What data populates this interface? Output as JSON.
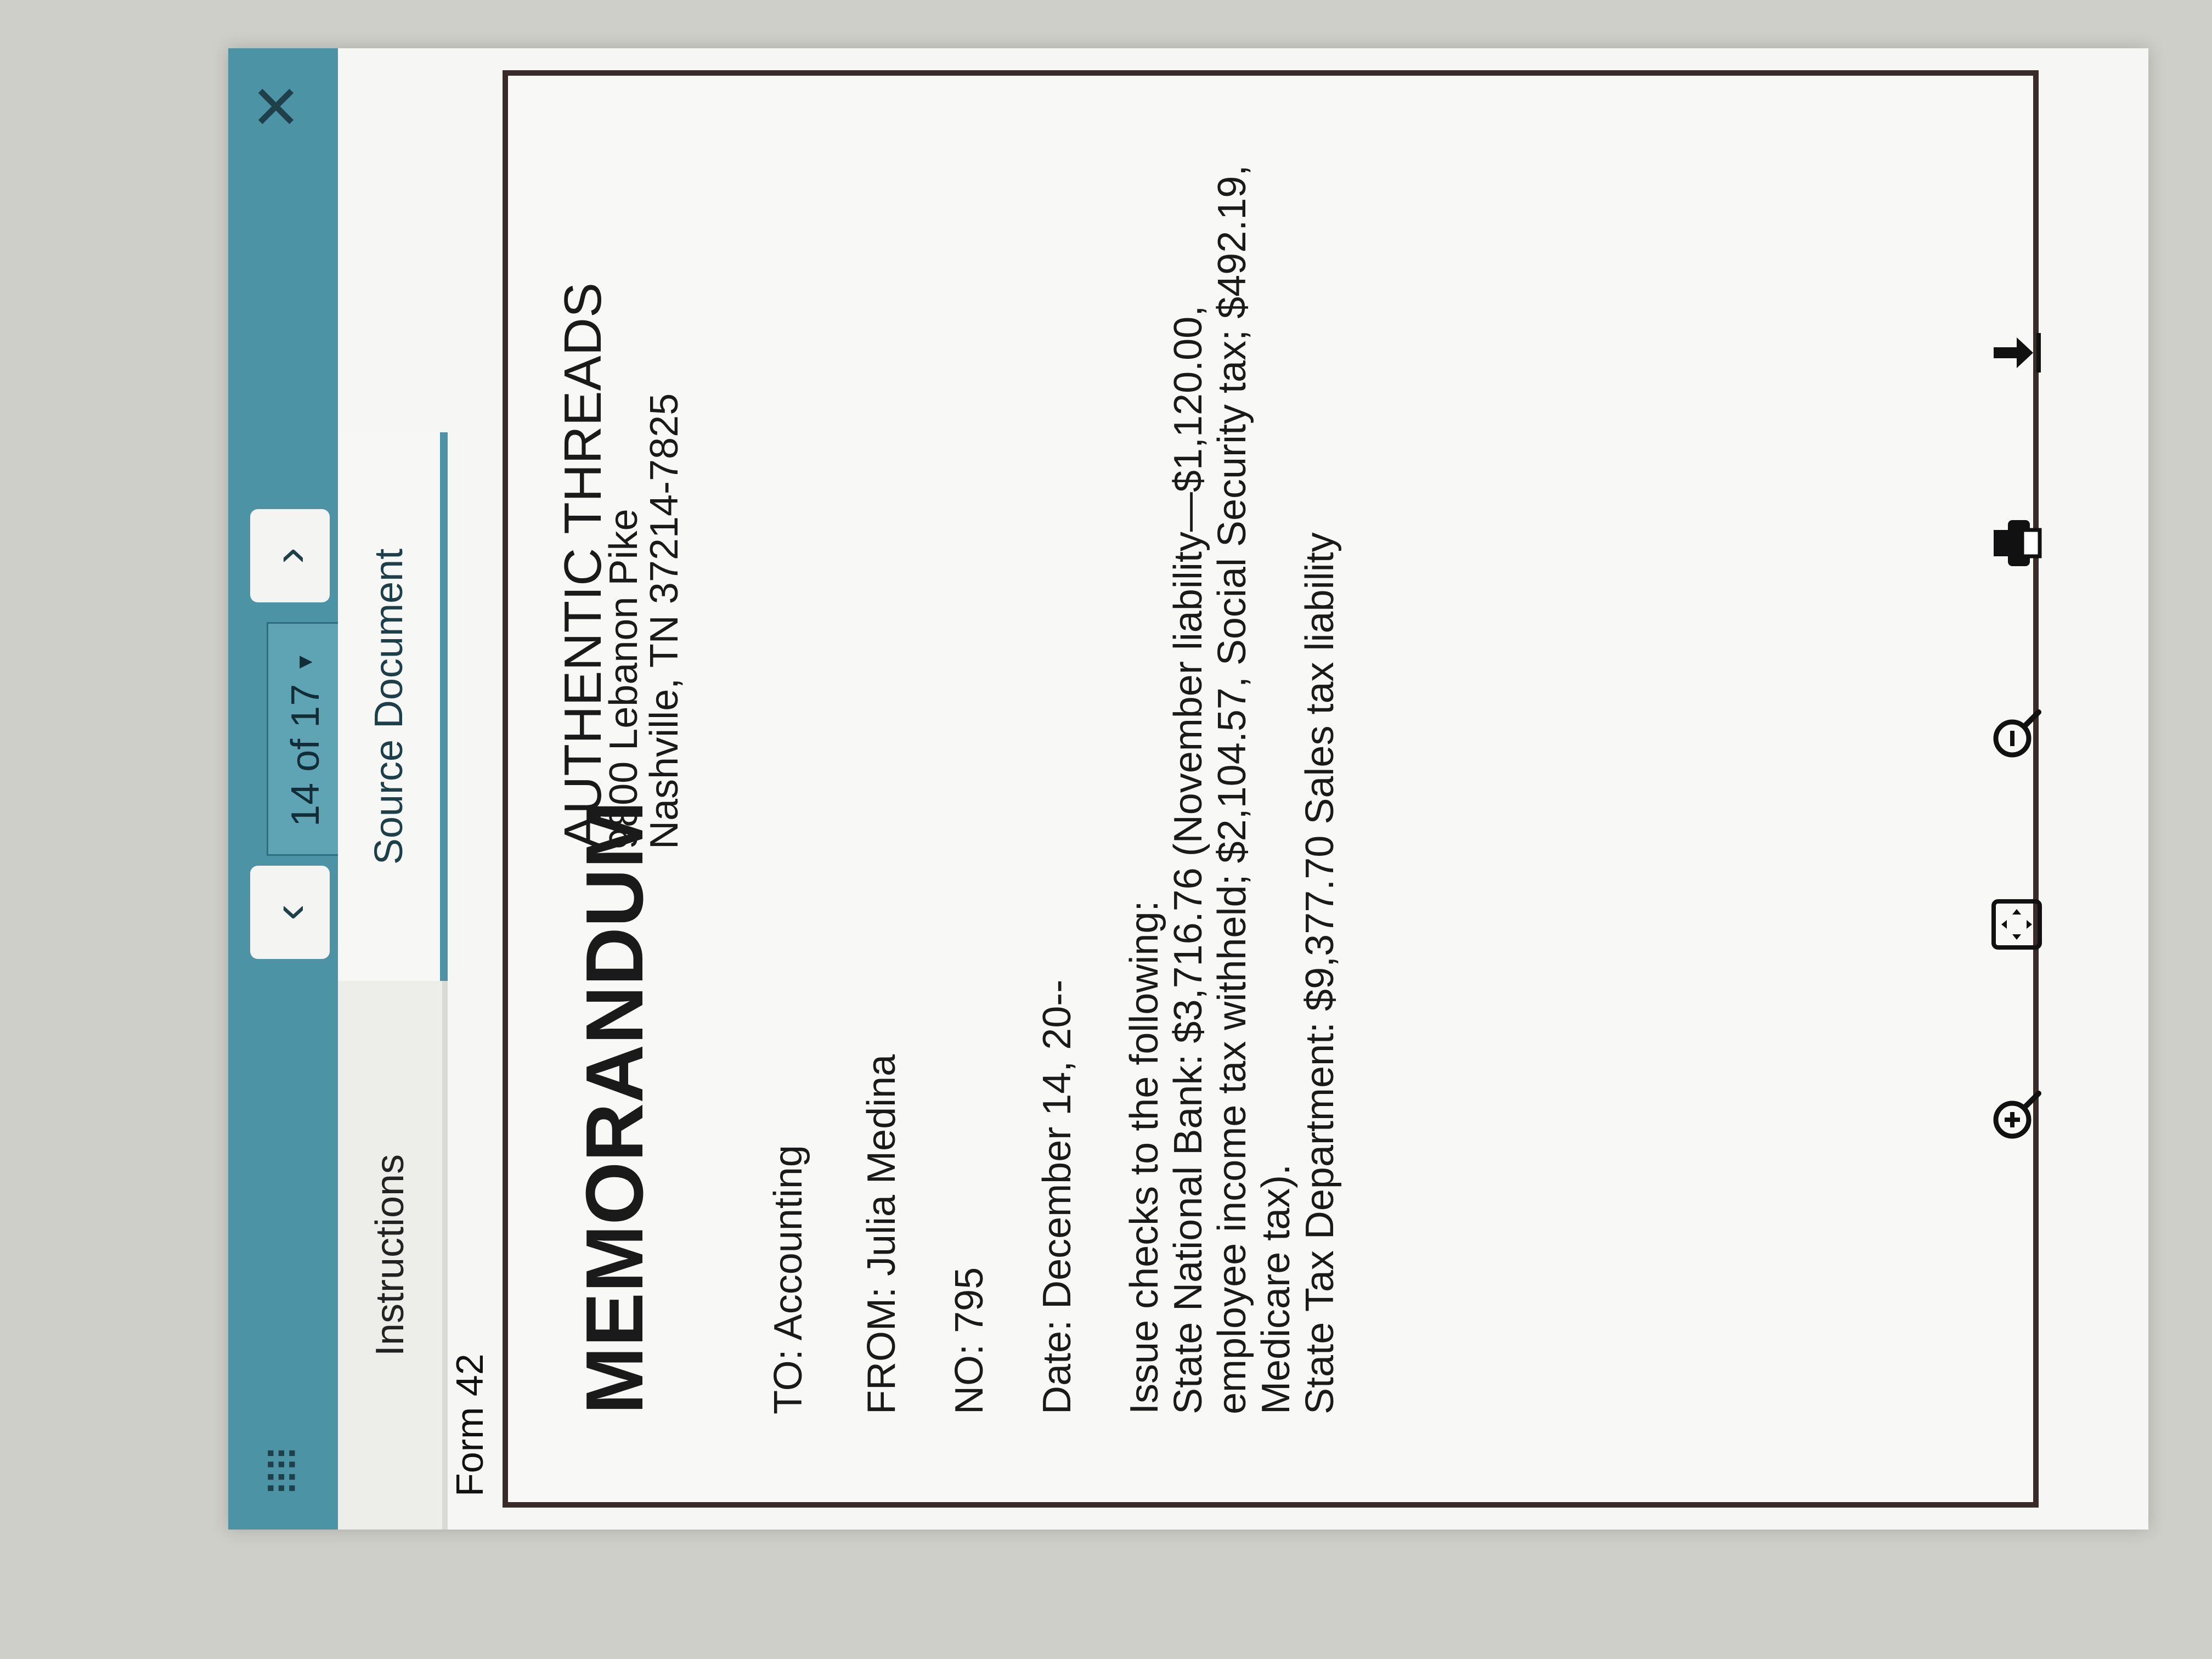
{
  "window": {
    "page_indicator": "14 of 17",
    "prev_icon": "chevron-left-icon",
    "next_icon": "chevron-right-icon",
    "close_icon": "close-icon",
    "grip_icon": "drag-grip-icon"
  },
  "tabs": [
    {
      "label": "Instructions",
      "active": false
    },
    {
      "label": "Source Document",
      "active": true
    }
  ],
  "form_label": "Form 42",
  "memo": {
    "title": "MEMORANDUM",
    "company_name": "AUTHENTIC THREADS",
    "address_line1": "9800 Lebanon Pike",
    "address_line2": "Nashville, TN 37214-7825",
    "to": "TO: Accounting",
    "from": "FROM: Julia Medina",
    "no": "NO: 795",
    "date": "Date: December 14, 20--",
    "body": [
      "Issue checks to the following:",
      "State National Bank: $3,716.76 (November liability—$1,120.00, employee income tax withheld; $2,104.57, Social Security tax; $492.19, Medicare tax).",
      "State Tax Department: $9,377.70 Sales tax liability"
    ]
  },
  "toolbar": {
    "icons": [
      "zoom-in-icon",
      "fit-screen-icon",
      "zoom-out-icon",
      "print-icon",
      "download-icon"
    ]
  },
  "colors": {
    "header": "#4d93a6",
    "tab_active_underline": "#4d93a6",
    "document_border": "#3a2b2b"
  }
}
